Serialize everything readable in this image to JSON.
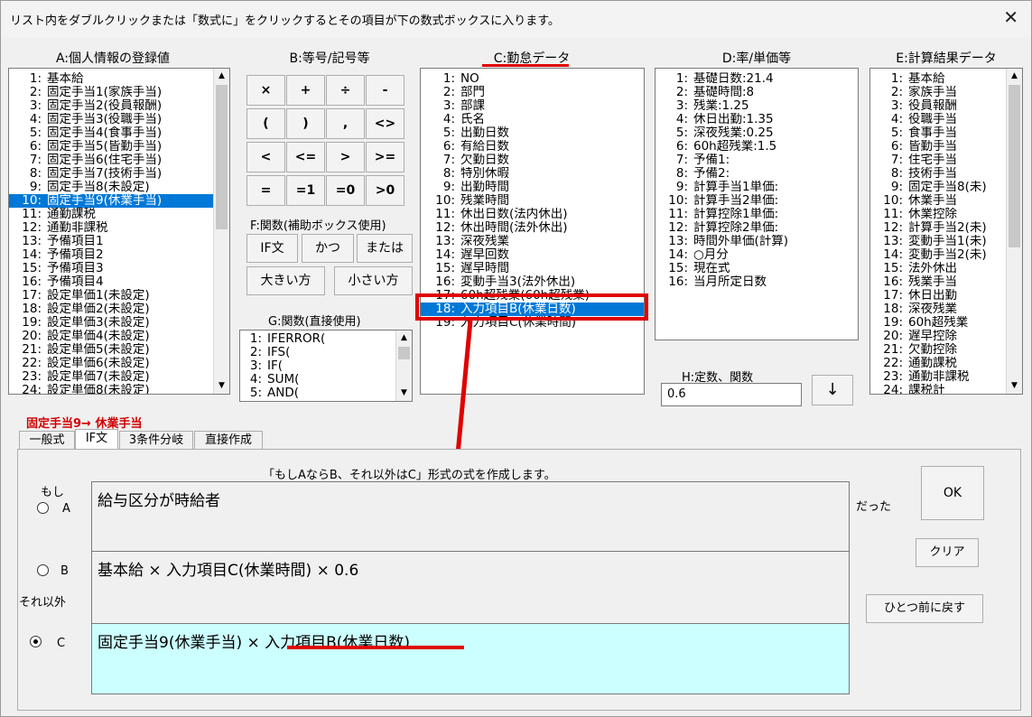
{
  "window": {
    "title": "リスト内をダブルクリックまたは「数式に」をクリックするとその項目が下の数式ボックスに入ります。",
    "close_glyph": "✕"
  },
  "list_a": {
    "label": "A:個人情報の登録値",
    "items": [
      {
        "num": "1:",
        "text": "基本給"
      },
      {
        "num": "2:",
        "text": "固定手当1(家族手当)"
      },
      {
        "num": "3:",
        "text": "固定手当2(役員報酬)"
      },
      {
        "num": "4:",
        "text": "固定手当3(役職手当)"
      },
      {
        "num": "5:",
        "text": "固定手当4(食事手当)"
      },
      {
        "num": "6:",
        "text": "固定手当5(皆勤手当)"
      },
      {
        "num": "7:",
        "text": "固定手当6(住宅手当)"
      },
      {
        "num": "8:",
        "text": "固定手当7(技術手当)"
      },
      {
        "num": "9:",
        "text": "固定手当8(未設定)"
      },
      {
        "num": "10:",
        "text": "固定手当9(休業手当)"
      },
      {
        "num": "11:",
        "text": "通勤課税"
      },
      {
        "num": "12:",
        "text": "通勤非課税"
      },
      {
        "num": "13:",
        "text": "予備項目1"
      },
      {
        "num": "14:",
        "text": "予備項目2"
      },
      {
        "num": "15:",
        "text": "予備項目3"
      },
      {
        "num": "16:",
        "text": "予備項目4"
      },
      {
        "num": "17:",
        "text": "設定単価1(未設定)"
      },
      {
        "num": "18:",
        "text": "設定単価2(未設定)"
      },
      {
        "num": "19:",
        "text": "設定単価3(未設定)"
      },
      {
        "num": "20:",
        "text": "設定単価4(未設定)"
      },
      {
        "num": "21:",
        "text": "設定単価5(未設定)"
      },
      {
        "num": "22:",
        "text": "設定単価6(未設定)"
      },
      {
        "num": "23:",
        "text": "設定単価7(未設定)"
      },
      {
        "num": "24:",
        "text": "設定単価8(未設定)"
      }
    ]
  },
  "group_b": {
    "label": "B:等号/記号等",
    "buttons": [
      "×",
      "+",
      "÷",
      "-",
      "(",
      ")",
      ",",
      "<>",
      "<",
      "<=",
      ">",
      ">=",
      "=",
      "=1",
      "=0",
      ">0"
    ]
  },
  "group_f": {
    "label": "F:関数(補助ボックス使用)",
    "buttons": [
      "IF文",
      "かつ",
      "または",
      "大きい方",
      "小さい方"
    ]
  },
  "list_g": {
    "label": "G:関数(直接使用)",
    "items": [
      {
        "num": "1:",
        "text": "IFERROR("
      },
      {
        "num": "2:",
        "text": "IFS("
      },
      {
        "num": "3:",
        "text": "IF("
      },
      {
        "num": "4:",
        "text": "SUM("
      },
      {
        "num": "5:",
        "text": "AND("
      }
    ]
  },
  "list_c": {
    "label": "C:勤怠データ",
    "items": [
      {
        "num": "1:",
        "text": "NO"
      },
      {
        "num": "2:",
        "text": "部門"
      },
      {
        "num": "3:",
        "text": "部課"
      },
      {
        "num": "4:",
        "text": "氏名"
      },
      {
        "num": "5:",
        "text": "出勤日数"
      },
      {
        "num": "6:",
        "text": "有給日数"
      },
      {
        "num": "7:",
        "text": "欠勤日数"
      },
      {
        "num": "8:",
        "text": "特別休暇"
      },
      {
        "num": "9:",
        "text": "出勤時間"
      },
      {
        "num": "10:",
        "text": "残業時間"
      },
      {
        "num": "11:",
        "text": "休出日数(法内休出)"
      },
      {
        "num": "12:",
        "text": "休出時間(法外休出)"
      },
      {
        "num": "13:",
        "text": "深夜残業"
      },
      {
        "num": "14:",
        "text": "遅早回数"
      },
      {
        "num": "15:",
        "text": "遅早時間"
      },
      {
        "num": "16:",
        "text": "変動手当3(法外休出)"
      },
      {
        "num": "17:",
        "text": "60h超残業(60h超残業)"
      },
      {
        "num": "18:",
        "text": "入力項目B(休業日数)"
      },
      {
        "num": "19:",
        "text": "入力項目C(休業時間)"
      }
    ],
    "selected_index": 17
  },
  "list_d": {
    "label": "D:率/単価等",
    "items": [
      {
        "num": "1:",
        "text": "基礎日数:21.4"
      },
      {
        "num": "2:",
        "text": "基礎時間:8"
      },
      {
        "num": "3:",
        "text": "残業:1.25"
      },
      {
        "num": "4:",
        "text": "休日出勤:1.35"
      },
      {
        "num": "5:",
        "text": "深夜残業:0.25"
      },
      {
        "num": "6:",
        "text": "60h超残業:1.5"
      },
      {
        "num": "7:",
        "text": "予備1:"
      },
      {
        "num": "8:",
        "text": "予備2:"
      },
      {
        "num": "9:",
        "text": "計算手当1単価:"
      },
      {
        "num": "10:",
        "text": "計算手当2単価:"
      },
      {
        "num": "11:",
        "text": "計算控除1単価:"
      },
      {
        "num": "12:",
        "text": "計算控除2単価:"
      },
      {
        "num": "13:",
        "text": "時間外単価(計算)"
      },
      {
        "num": "14:",
        "text": "○月分"
      },
      {
        "num": "15:",
        "text": "現在式"
      },
      {
        "num": "16:",
        "text": "当月所定日数"
      }
    ]
  },
  "const_h": {
    "label": "H:定数、関数",
    "value": "0.6",
    "button": "↓"
  },
  "list_e": {
    "label": "E:計算結果データ",
    "items": [
      {
        "num": "1:",
        "text": "基本給"
      },
      {
        "num": "2:",
        "text": "家族手当"
      },
      {
        "num": "3:",
        "text": "役員報酬"
      },
      {
        "num": "4:",
        "text": "役職手当"
      },
      {
        "num": "5:",
        "text": "食事手当"
      },
      {
        "num": "6:",
        "text": "皆勤手当"
      },
      {
        "num": "7:",
        "text": "住宅手当"
      },
      {
        "num": "8:",
        "text": "技術手当"
      },
      {
        "num": "9:",
        "text": "固定手当8(未)"
      },
      {
        "num": "10:",
        "text": "休業手当"
      },
      {
        "num": "11:",
        "text": "休業控除"
      },
      {
        "num": "12:",
        "text": "計算手当2(未)"
      },
      {
        "num": "13:",
        "text": "変動手当1(未)"
      },
      {
        "num": "14:",
        "text": "変動手当2(未)"
      },
      {
        "num": "15:",
        "text": "法外休出"
      },
      {
        "num": "16:",
        "text": "残業手当"
      },
      {
        "num": "17:",
        "text": "休日出勤"
      },
      {
        "num": "18:",
        "text": "深夜残業"
      },
      {
        "num": "19:",
        "text": "60h超残業"
      },
      {
        "num": "20:",
        "text": "遅早控除"
      },
      {
        "num": "21:",
        "text": "欠勤控除"
      },
      {
        "num": "22:",
        "text": "通勤課税"
      },
      {
        "num": "23:",
        "text": "通勤非課税"
      },
      {
        "num": "24:",
        "text": "課税計"
      }
    ]
  },
  "target_label": "固定手当9→ 休業手当",
  "tabs": [
    "一般式",
    "IF文",
    "3条件分岐",
    "直接作成"
  ],
  "active_tab": 1,
  "if_panel": {
    "description": "「もしAならB、それ以外はC」形式の式を作成します。",
    "moshi_label": "もし",
    "datta_label": "だった",
    "else_label": "それ以外",
    "radio_a": "A",
    "radio_b": "B",
    "radio_c": "C",
    "selected_radio": "C",
    "cond_a": "給与区分が時給者",
    "cond_b": "基本給 × 入力項目C(休業時間) × 0.6",
    "cond_c_prefix": "固定手当9(休業手当) × ",
    "cond_c_highlight": "入力項目B(休業日数)",
    "ok_button": "OK",
    "clear_button": "クリア",
    "undo_button": "ひとつ前に戻す"
  },
  "colors": {
    "selection": "#0078d7",
    "annotation_red": "#e00000",
    "target_label": "#d00000",
    "selected_field": "#ccffff"
  }
}
